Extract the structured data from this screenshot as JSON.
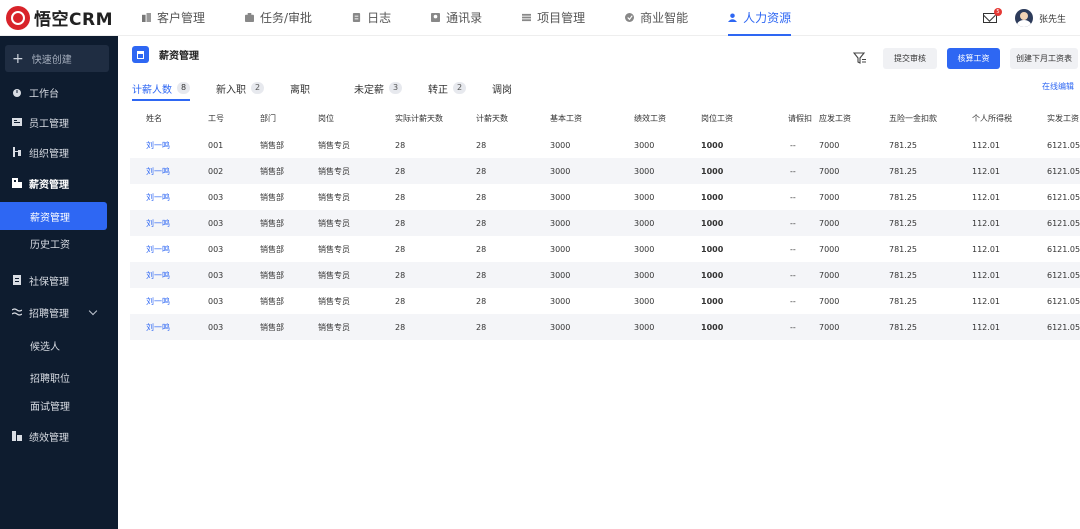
{
  "app": {
    "logo_text": "悟空CRM"
  },
  "topnav": [
    {
      "label": "客户管理",
      "icon": "customer-icon",
      "active": false
    },
    {
      "label": "任务/审批",
      "icon": "task-icon",
      "active": false
    },
    {
      "label": "日志",
      "icon": "log-icon",
      "active": false
    },
    {
      "label": "通讯录",
      "icon": "contacts-icon",
      "active": false
    },
    {
      "label": "项目管理",
      "icon": "project-icon",
      "active": false
    },
    {
      "label": "商业智能",
      "icon": "bi-icon",
      "active": false
    },
    {
      "label": "人力资源",
      "icon": "hr-icon",
      "active": true
    }
  ],
  "user": {
    "name": "张先生",
    "mail_badge": "5"
  },
  "sidebar": {
    "quick_create": "快速创建",
    "items": [
      {
        "label": "工作台"
      },
      {
        "label": "员工管理"
      },
      {
        "label": "组织管理"
      },
      {
        "label": "薪资管理"
      },
      {
        "label": "薪资管理"
      },
      {
        "label": "历史工资"
      },
      {
        "label": "社保管理"
      },
      {
        "label": "招聘管理"
      },
      {
        "label": "候选人"
      },
      {
        "label": "招聘职位"
      },
      {
        "label": "面试管理"
      },
      {
        "label": "绩效管理"
      }
    ]
  },
  "page": {
    "title": "薪资管理",
    "buttons": {
      "submit": "提交审核",
      "calc": "核算工资",
      "create_next": "创建下月工资表"
    },
    "online_edit": "在线编辑"
  },
  "tabs": [
    {
      "label": "计薪人数",
      "count": "8"
    },
    {
      "label": "新入职",
      "count": "2"
    },
    {
      "label": "离职",
      "count": ""
    },
    {
      "label": "未定薪",
      "count": "3"
    },
    {
      "label": "转正",
      "count": "2"
    },
    {
      "label": "调岗",
      "count": ""
    }
  ],
  "table": {
    "headers": [
      "姓名",
      "工号",
      "部门",
      "岗位",
      "实际计薪天数",
      "计薪天数",
      "基本工资",
      "绩效工资",
      "岗位工资",
      "请假扣",
      "应发工资",
      "五险一金扣款",
      "个人所得税",
      "实发工资"
    ],
    "rows": [
      [
        "刘一鸣",
        "001",
        "销售部",
        "销售专员",
        "28",
        "28",
        "3000",
        "3000",
        "1000",
        "--",
        "7000",
        "781.25",
        "112.01",
        "6121.05"
      ],
      [
        "刘一鸣",
        "002",
        "销售部",
        "销售专员",
        "28",
        "28",
        "3000",
        "3000",
        "1000",
        "--",
        "7000",
        "781.25",
        "112.01",
        "6121.05"
      ],
      [
        "刘一鸣",
        "003",
        "销售部",
        "销售专员",
        "28",
        "28",
        "3000",
        "3000",
        "1000",
        "--",
        "7000",
        "781.25",
        "112.01",
        "6121.05"
      ],
      [
        "刘一鸣",
        "003",
        "销售部",
        "销售专员",
        "28",
        "28",
        "3000",
        "3000",
        "1000",
        "--",
        "7000",
        "781.25",
        "112.01",
        "6121.05"
      ],
      [
        "刘一鸣",
        "003",
        "销售部",
        "销售专员",
        "28",
        "28",
        "3000",
        "3000",
        "1000",
        "--",
        "7000",
        "781.25",
        "112.01",
        "6121.05"
      ],
      [
        "刘一鸣",
        "003",
        "销售部",
        "销售专员",
        "28",
        "28",
        "3000",
        "3000",
        "1000",
        "--",
        "7000",
        "781.25",
        "112.01",
        "6121.05"
      ],
      [
        "刘一鸣",
        "003",
        "销售部",
        "销售专员",
        "28",
        "28",
        "3000",
        "3000",
        "1000",
        "--",
        "7000",
        "781.25",
        "112.01",
        "6121.05"
      ],
      [
        "刘一鸣",
        "003",
        "销售部",
        "销售专员",
        "28",
        "28",
        "3000",
        "3000",
        "1000",
        "--",
        "7000",
        "781.25",
        "112.01",
        "6121.05"
      ]
    ]
  },
  "colors": {
    "accent": "#2e67f3",
    "sidebar_bg": "#0e1c2f",
    "stripe": "#f4f5f8",
    "logo_red": "#d8232a"
  }
}
